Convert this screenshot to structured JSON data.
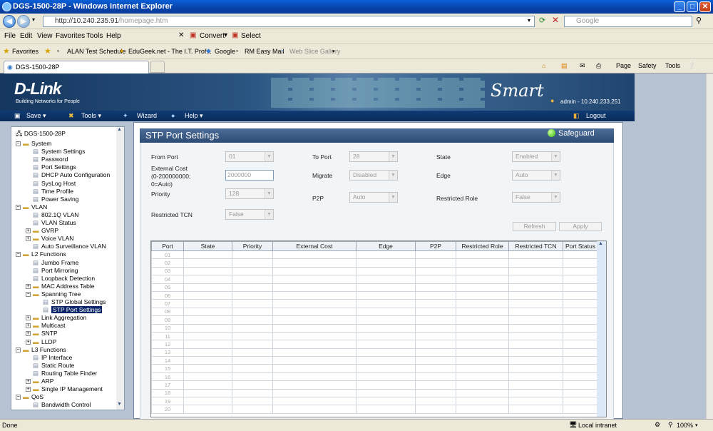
{
  "window": {
    "title": "DGS-1500-28P - Windows Internet Explorer"
  },
  "browser": {
    "url_prefix": "http://10.240.235.91",
    "url_path": "/homepage.htm",
    "search_placeholder": "Google",
    "menu": [
      "File",
      "Edit",
      "View",
      "Favorites",
      "Tools",
      "Help"
    ],
    "menu_extra": [
      "Convert",
      "Select"
    ],
    "favorites_label": "Favorites",
    "favorites": [
      "ALAN Test Schedule",
      "EduGeek.net - The I.T. Prof...",
      "Google",
      "RM Easy Mail",
      "Web Slice Gallery"
    ],
    "tab_title": "DGS-1500-28P",
    "commands": [
      "Page",
      "Safety",
      "Tools"
    ],
    "status_left": "Done",
    "zone": "Local intranet",
    "zoom": "100%"
  },
  "banner": {
    "logo": "D-Link",
    "tagline": "Building Networks for People",
    "product": "Smart",
    "user": "admin - 10.240.233.251"
  },
  "toolbar": {
    "save": "Save",
    "tools": "Tools",
    "wizard": "Wizard",
    "help": "Help",
    "logout": "Logout"
  },
  "tree": {
    "root": "DGS-1500-28P",
    "items": [
      {
        "label": "System",
        "level": 1,
        "type": "folder"
      },
      {
        "label": "System Settings",
        "level": 2,
        "type": "page"
      },
      {
        "label": "Password",
        "level": 2,
        "type": "page"
      },
      {
        "label": "Port Settings",
        "level": 2,
        "type": "page"
      },
      {
        "label": "DHCP Auto Configuration",
        "level": 2,
        "type": "page"
      },
      {
        "label": "SysLog Host",
        "level": 2,
        "type": "page"
      },
      {
        "label": "Time Profile",
        "level": 2,
        "type": "page"
      },
      {
        "label": "Power Saving",
        "level": 2,
        "type": "page"
      },
      {
        "label": "VLAN",
        "level": 1,
        "type": "folder"
      },
      {
        "label": "802.1Q VLAN",
        "level": 2,
        "type": "page"
      },
      {
        "label": "VLAN Status",
        "level": 2,
        "type": "page"
      },
      {
        "label": "GVRP",
        "level": 2,
        "type": "folder-closed"
      },
      {
        "label": "Voice VLAN",
        "level": 2,
        "type": "folder-closed"
      },
      {
        "label": "Auto Surveillance VLAN",
        "level": 2,
        "type": "page"
      },
      {
        "label": "L2 Functions",
        "level": 1,
        "type": "folder"
      },
      {
        "label": "Jumbo Frame",
        "level": 2,
        "type": "page"
      },
      {
        "label": "Port Mirroring",
        "level": 2,
        "type": "page"
      },
      {
        "label": "Loopback Detection",
        "level": 2,
        "type": "page"
      },
      {
        "label": "MAC Address Table",
        "level": 2,
        "type": "folder-closed"
      },
      {
        "label": "Spanning Tree",
        "level": 2,
        "type": "folder"
      },
      {
        "label": "STP Global Settings",
        "level": 3,
        "type": "page"
      },
      {
        "label": "STP Port Settings",
        "level": 3,
        "type": "page",
        "selected": true
      },
      {
        "label": "Link Aggregation",
        "level": 2,
        "type": "folder-closed"
      },
      {
        "label": "Multicast",
        "level": 2,
        "type": "folder-closed"
      },
      {
        "label": "SNTP",
        "level": 2,
        "type": "folder-closed"
      },
      {
        "label": "LLDP",
        "level": 2,
        "type": "folder-closed"
      },
      {
        "label": "L3 Functions",
        "level": 1,
        "type": "folder"
      },
      {
        "label": "IP Interface",
        "level": 2,
        "type": "page"
      },
      {
        "label": "Static Route",
        "level": 2,
        "type": "page"
      },
      {
        "label": "Routing Table Finder",
        "level": 2,
        "type": "page"
      },
      {
        "label": "ARP",
        "level": 2,
        "type": "folder-closed"
      },
      {
        "label": "Single IP Management",
        "level": 2,
        "type": "folder-closed"
      },
      {
        "label": "QoS",
        "level": 1,
        "type": "folder"
      },
      {
        "label": "Bandwidth Control",
        "level": 2,
        "type": "page"
      }
    ]
  },
  "panel": {
    "title": "STP Port Settings",
    "safeguard": "Safeguard",
    "labels": {
      "from_port": "From Port",
      "to_port": "To Port",
      "state": "State",
      "external_cost_1": "External Cost",
      "external_cost_2": "(0-200000000;",
      "external_cost_3": "0=Auto)",
      "migrate": "Migrate",
      "edge": "Edge",
      "priority": "Priority",
      "p2p": "P2P",
      "restricted_role": "Restricted Role",
      "restricted_tcn": "Restricted TCN"
    },
    "values": {
      "from_port": "01",
      "to_port": "28",
      "state": "Enabled",
      "external_cost": "2000000",
      "migrate": "Disabled",
      "edge": "Auto",
      "priority": "128",
      "p2p": "Auto",
      "restricted_role": "False",
      "restricted_tcn": "False"
    },
    "buttons": {
      "refresh": "Refresh",
      "apply": "Apply"
    },
    "table": {
      "columns": [
        "Port",
        "State",
        "Priority",
        "External Cost",
        "Edge",
        "P2P",
        "Restricted Role",
        "Restricted TCN",
        "Port Status"
      ],
      "rows": [
        "01",
        "02",
        "03",
        "04",
        "05",
        "06",
        "07",
        "08",
        "09",
        "10",
        "11",
        "12",
        "13",
        "14",
        "15",
        "16",
        "17",
        "18",
        "19",
        "20"
      ]
    }
  }
}
